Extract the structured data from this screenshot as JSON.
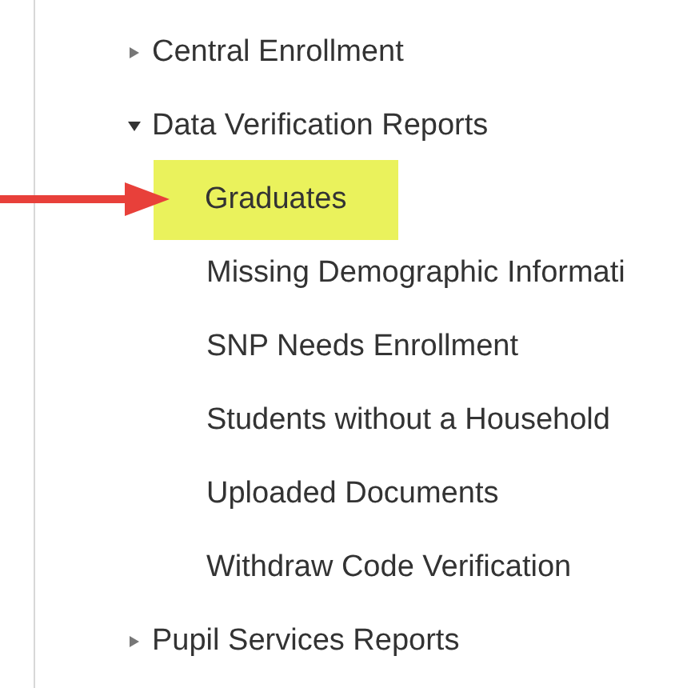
{
  "tree": [
    {
      "label": "Central Enrollment",
      "expanded": false
    },
    {
      "label": "Data Verification Reports",
      "expanded": true,
      "children": [
        {
          "label": "Graduates",
          "selected": true
        },
        {
          "label": "Missing Demographic Informati",
          "selected": false
        },
        {
          "label": "SNP Needs Enrollment",
          "selected": false
        },
        {
          "label": "Students without a Household",
          "selected": false
        },
        {
          "label": "Uploaded Documents",
          "selected": false
        },
        {
          "label": "Withdraw Code Verification",
          "selected": false
        }
      ]
    },
    {
      "label": "Pupil Services Reports",
      "expanded": false
    }
  ],
  "annotation": {
    "kind": "arrow"
  }
}
